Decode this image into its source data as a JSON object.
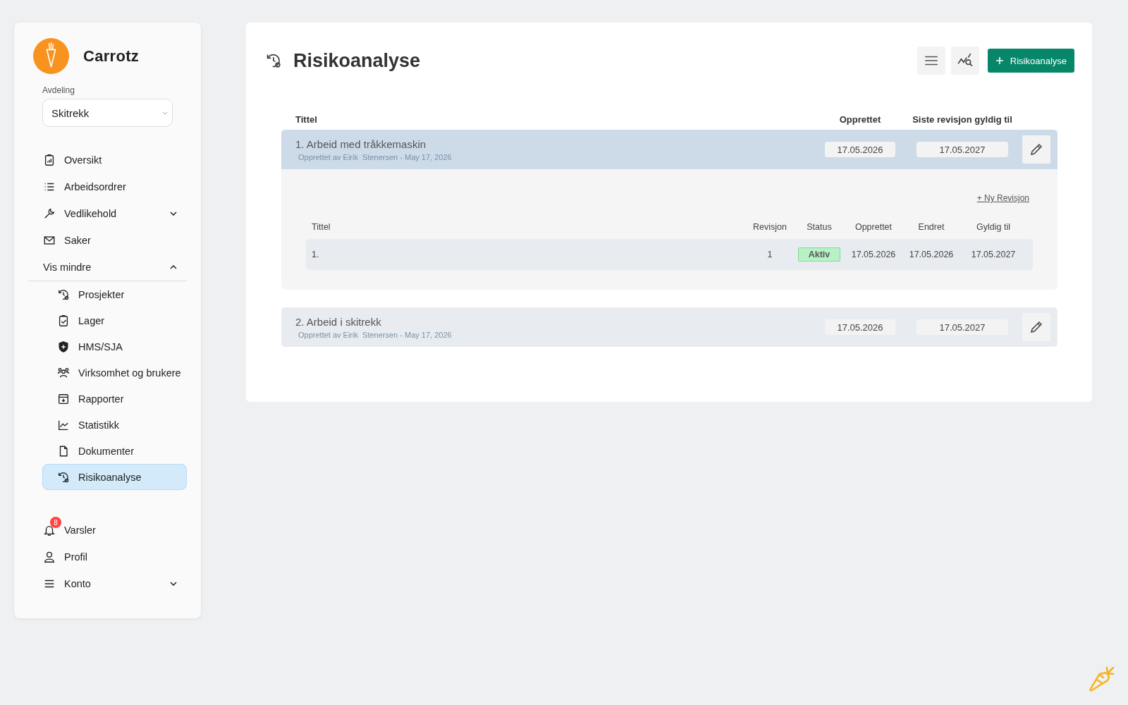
{
  "sidebar": {
    "brand": "Carrotz",
    "department": {
      "label": "Avdeling",
      "value": "Skitrekk"
    },
    "nav": [
      {
        "label": "Oversikt",
        "selected": false
      },
      {
        "label": "Arbeidsordrer",
        "selected": false
      },
      {
        "label": "Vedlikehold",
        "selected": false,
        "expanded": false
      },
      {
        "label": "Saker",
        "selected": false
      },
      {
        "label": "Vis mindre",
        "selected": false,
        "expanded": true,
        "children": [
          {
            "label": "Prosjekter",
            "selected": false
          },
          {
            "label": "Lager",
            "selected": false
          },
          {
            "label": "HMS/SJA",
            "selected": false
          },
          {
            "label": "Virksomhet og brukere",
            "selected": false
          },
          {
            "label": "Rapporter",
            "selected": false
          },
          {
            "label": "Statistikk",
            "selected": false
          },
          {
            "label": "Dokumenter",
            "selected": false
          },
          {
            "label": "Risikoanalyse",
            "selected": true
          }
        ]
      }
    ],
    "footer_nav": [
      {
        "label": "Varsler",
        "selected": false,
        "badge": "8"
      },
      {
        "label": "Profil",
        "selected": false
      },
      {
        "label": "Konto",
        "selected": false,
        "expanded": false
      }
    ]
  },
  "main": {
    "title": "Risikoanalyse",
    "add_button": "Risikoanalyse",
    "table": {
      "columns": [
        "Tittel",
        "Opprettet",
        "Siste revisjon gyldig til"
      ],
      "rows": [
        {
          "title": "1. Arbeid med tråkkemaskin",
          "meta": "Opprettet av Eirik  Stenersen - May 17, 2026",
          "created": "17.05.2026",
          "valid_until": "17.05.2027",
          "expanded": true,
          "revisions": {
            "new_link": "+ Ny Revisjon",
            "columns": [
              "Tittel",
              "Revisjon",
              "Status",
              "Opprettet",
              "Endret",
              "Gyldig til"
            ],
            "rows": [
              {
                "title": "1.",
                "revision": "1",
                "status": "Aktiv",
                "created": "17.05.2026",
                "changed": "17.05.2026",
                "valid_until": "17.05.2027"
              }
            ]
          }
        },
        {
          "title": "2. Arbeid i skitrekk",
          "meta": "Opprettet av Eirik  Stenersen - May 17, 2026",
          "created": "17.05.2026",
          "valid_until": "17.05.2027",
          "expanded": false
        }
      ]
    }
  }
}
